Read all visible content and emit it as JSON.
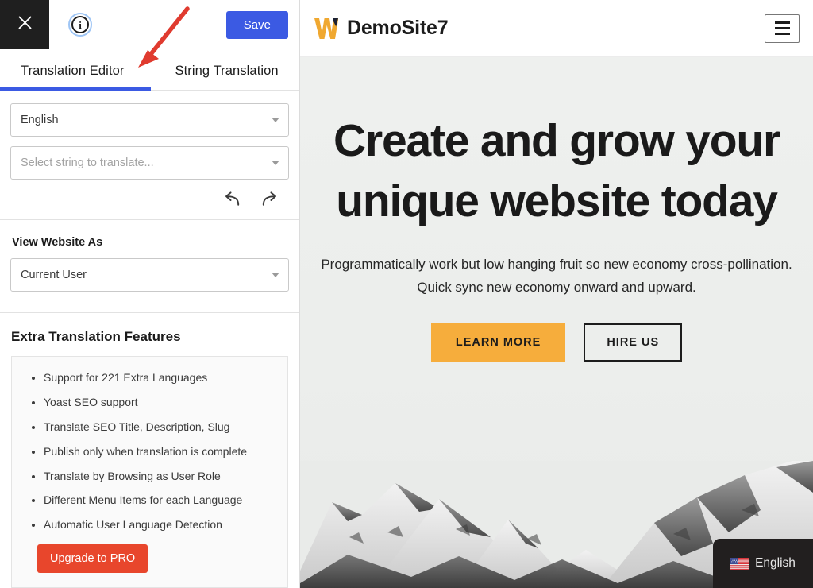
{
  "sidebar": {
    "topbar": {
      "close_icon": "close-icon",
      "info_icon": "info-icon",
      "info_glyph": "i",
      "save_label": "Save"
    },
    "tabs": [
      {
        "label": "Translation Editor",
        "active": true
      },
      {
        "label": "String Translation",
        "active": false
      }
    ],
    "language_select": {
      "value": "English",
      "caret_icon": "chevron-down-icon"
    },
    "string_select": {
      "placeholder": "Select string to translate...",
      "caret_icon": "chevron-down-icon"
    },
    "history": {
      "undo_icon": "undo-arrow-icon",
      "redo_icon": "redo-arrow-icon"
    },
    "view_as": {
      "label": "View Website As",
      "value": "Current User",
      "caret_icon": "chevron-down-icon"
    },
    "features": {
      "title": "Extra Translation Features",
      "items": [
        "Support for 221 Extra Languages",
        "Yoast SEO support",
        "Translate SEO Title, Description, Slug",
        "Publish only when translation is complete",
        "Translate by Browsing as User Role",
        "Different Menu Items for each Language",
        "Automatic User Language Detection"
      ],
      "upgrade_label": "Upgrade to PRO"
    },
    "annotation": {
      "arrow_icon": "red-pointer-arrow-icon",
      "color": "#e03b2f"
    }
  },
  "preview": {
    "header": {
      "logo_icon": "w-logo-icon",
      "site_name": "DemoSite7",
      "menu_icon": "hamburger-menu-icon"
    },
    "hero": {
      "heading": "Create and grow your unique website today",
      "paragraph": "Programmatically work but low hanging fruit so new economy cross-pollination. Quick sync new economy onward and upward.",
      "primary_cta": "LEARN MORE",
      "secondary_cta": "HIRE US",
      "background_image": "snow-capped-mountains-photo"
    },
    "language_switcher": {
      "flag_icon": "us-flag-icon",
      "label": "English"
    }
  },
  "colors": {
    "save_blue": "#3b5ae3",
    "tab_underline": "#3b5ae3",
    "upgrade_red": "#e8462c",
    "cta_orange": "#f6ad3c",
    "logo_orange": "#f0a830",
    "logo_navy": "#1c2233",
    "annotation_red": "#e03b2f",
    "hero_bg": "#ecefec",
    "switcher_bg": "#221f1f"
  }
}
